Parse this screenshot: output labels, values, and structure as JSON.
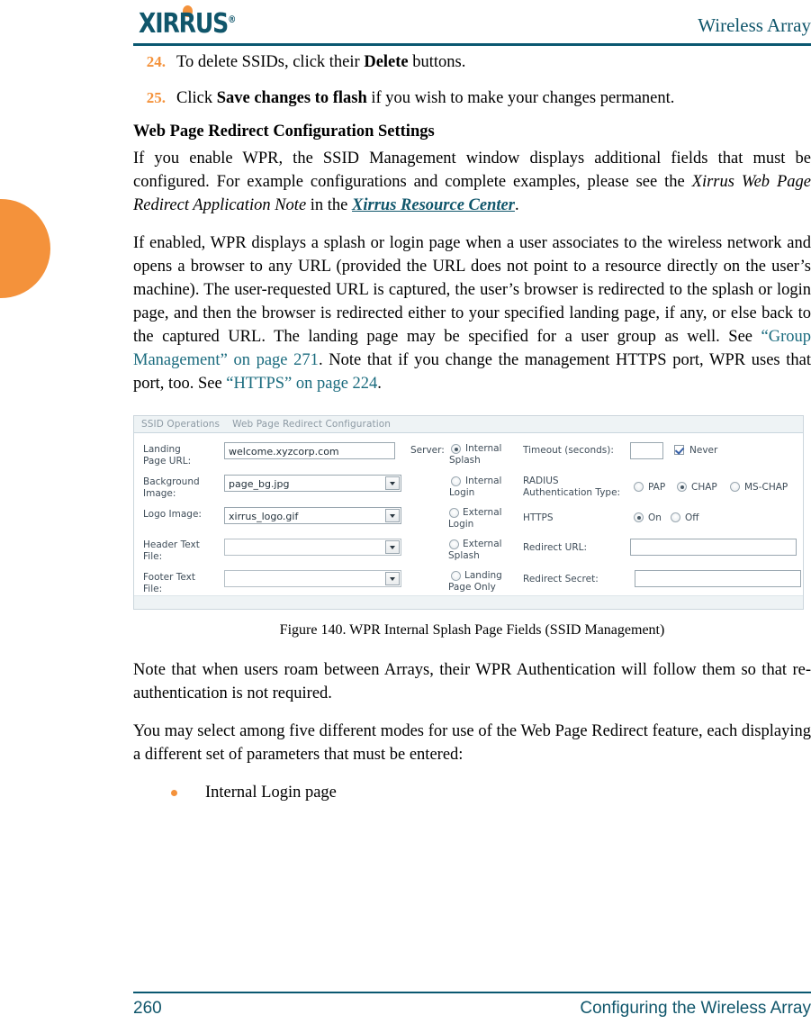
{
  "header": {
    "logo_text": "XIRRUS",
    "logo_registered": "®",
    "title": "Wireless Array"
  },
  "steps": [
    {
      "number": "24.",
      "html": "To delete SSIDs, click their <strong>Delete</strong> buttons."
    },
    {
      "number": "25.",
      "html": "Click <strong>Save changes to flash</strong> if you wish to make your changes permanent."
    }
  ],
  "section": {
    "heading": "Web Page Redirect Configuration Settings",
    "paragraph1_html": "If you enable WPR, the SSID Management window displays additional fields that must be configured. For example configurations and complete examples, please see the <em>Xirrus Web Page Redirect Application Note</em> in the <span class=\"link-res\">Xirrus Resource Center</span>.",
    "paragraph2_html": "If enabled, WPR displays a splash or login page when a user associates to the wireless network and opens a browser to any URL (provided the URL does not point to a resource directly on the user’s machine). The user-requested URL is captured, the user’s browser is redirected to the splash or login page, and then the browser is redirected either to your specified landing page, if any, or else back to the captured URL. The landing page may be specified for a user group as well. See <span class=\"link-teal\">“Group Management” on page 271</span>. Note that if you change the management HTTPS port, WPR uses that port, too. See <span class=\"link-teal\">“HTTPS” on page 224</span>."
  },
  "appshot": {
    "tabs": [
      {
        "label": "SSID Operations",
        "active": false
      },
      {
        "label": "Web Page Redirect Configuration",
        "active": true
      }
    ],
    "fields": {
      "landing_page_url_label": "Landing Page URL:",
      "landing_page_url_value": "welcome.xyzcorp.com",
      "background_image_label": "Background Image:",
      "background_image_value": "page_bg.jpg",
      "logo_image_label": "Logo Image:",
      "logo_image_value": "xirrus_logo.gif",
      "header_text_file_label": "Header Text File:",
      "header_text_file_value": "",
      "footer_text_file_label": "Footer Text File:",
      "footer_text_file_value": "",
      "server_label": "Server:",
      "timeout_label": "Timeout (seconds):",
      "timeout_value": "",
      "never_label": "Never",
      "radius_auth_label": "RADIUS Authentication Type:",
      "https_label": "HTTPS",
      "redirect_url_label": "Redirect URL:",
      "redirect_url_value": "",
      "redirect_secret_label": "Redirect Secret:",
      "redirect_secret_value": ""
    },
    "server_options": [
      {
        "label": "Internal Splash",
        "line1": "Internal",
        "line2": "Splash",
        "selected": true
      },
      {
        "label": "Internal Login",
        "line1": "Internal",
        "line2": "Login",
        "selected": false
      },
      {
        "label": "External Login",
        "line1": "External",
        "line2": "Login",
        "selected": false
      },
      {
        "label": "External Splash",
        "line1": "External",
        "line2": "Splash",
        "selected": false
      },
      {
        "label": "Landing Page Only",
        "line1": "Landing",
        "line2": "Page Only",
        "selected": false
      }
    ],
    "radius_options": [
      {
        "label": "PAP",
        "selected": false
      },
      {
        "label": "CHAP",
        "selected": true
      },
      {
        "label": "MS-CHAP",
        "selected": false
      }
    ],
    "https_options": [
      {
        "label": "On",
        "selected": true
      },
      {
        "label": "Off",
        "selected": false
      }
    ],
    "never_checked": true
  },
  "figure": {
    "caption": "Figure 140. WPR Internal Splash Page Fields (SSID Management)"
  },
  "after_figure": {
    "paragraph1": "Note that when users roam between Arrays, their WPR Authentication will follow them so that re-authentication is not required.",
    "paragraph2": "You may select among five different modes for use of the Web Page Redirect feature, each displaying a different set of parameters that must be entered:",
    "bullets": [
      "Internal Login page"
    ]
  },
  "footer": {
    "page_number": "260",
    "section_title": "Configuring the Wireless Array"
  },
  "colors": {
    "brand_teal": "#10566B",
    "accent_orange": "#F4923B",
    "link_teal": "#1A6B7E"
  }
}
